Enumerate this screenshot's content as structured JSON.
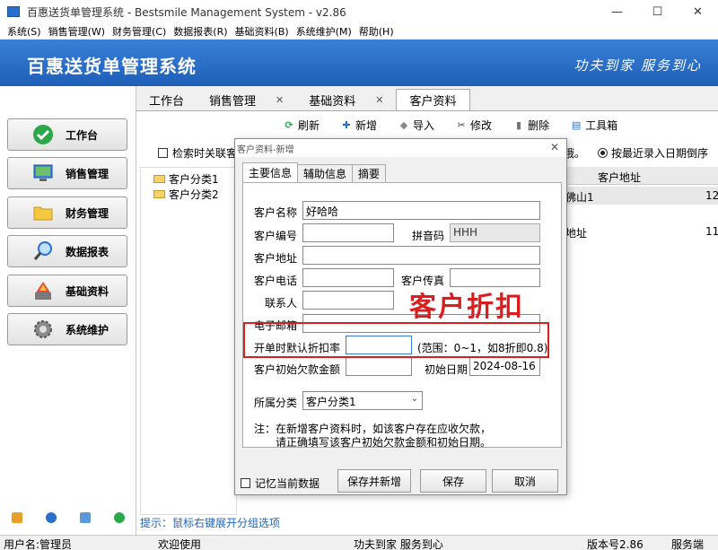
{
  "window": {
    "title": "百惠送货单管理系统 - Bestsmile Management System - v2.86",
    "minimize_glyph": "—",
    "maximize_glyph": "☐",
    "close_glyph": "✕"
  },
  "menu": [
    "系统(S)",
    "销售管理(W)",
    "财务管理(C)",
    "数据报表(R)",
    "基础资料(B)",
    "系统维护(M)",
    "帮助(H)"
  ],
  "banner": {
    "system_name": "百惠送货单管理系统",
    "slogan": "功夫到家 服务到心"
  },
  "nav": [
    {
      "label": "工作台",
      "icon": "checkmark-icon"
    },
    {
      "label": "销售管理",
      "icon": "monitor-icon"
    },
    {
      "label": "财务管理",
      "icon": "folder-icon"
    },
    {
      "label": "数据报表",
      "icon": "magnifier-icon"
    },
    {
      "label": "基础资料",
      "icon": "palette-icon"
    },
    {
      "label": "系统维护",
      "icon": "gear-icon"
    }
  ],
  "tabs": [
    {
      "label": "工作台",
      "closable": false
    },
    {
      "label": "销售管理",
      "closable": true
    },
    {
      "label": "基础资料",
      "closable": true
    },
    {
      "label": "客户资料",
      "closable": false
    }
  ],
  "toolbar": {
    "refresh": "刷新",
    "add": "新增",
    "import": "导入",
    "edit": "修改",
    "delete": "删除",
    "toolbox": "工具箱"
  },
  "search": {
    "checkbox_label": "检索时关联客",
    "radio_label": "按最近录入日期倒序",
    "partial_text": "哦。"
  },
  "tree": [
    "客户分类1",
    "客户分类2"
  ],
  "grid": {
    "column": "客户地址",
    "rows": [
      {
        "addr": "佛山1",
        "num": "12"
      },
      {
        "addr": "地址",
        "num": "11"
      }
    ]
  },
  "hint": "提示：鼠标右键展开分组选项",
  "statusbar": {
    "user": "用户名:管理员",
    "welcome": "欢迎使用",
    "slogan": "功夫到家 服务到心",
    "version": "版本号2.86",
    "service": "服务端"
  },
  "dialog": {
    "title": "客户资料-新增",
    "close_glyph": "✕",
    "tabs": [
      "主要信息",
      "辅助信息",
      "摘要"
    ],
    "fields": {
      "name_label": "客户名称",
      "name_value": "好哈哈",
      "code_label": "客户编号",
      "code_value": "",
      "pinyin_label": "拼音码",
      "pinyin_value": "HHH",
      "address_label": "客户地址",
      "address_value": "",
      "phone_label": "客户电话",
      "phone_value": "",
      "fax_label": "客户传真",
      "fax_value": "",
      "contact_label": "联系人",
      "contact_value": "",
      "email_label": "电子邮箱",
      "email_value": "",
      "discount_label": "开单时默认折扣率",
      "discount_value": "",
      "discount_hint": "(范围：0~1，如8折即0.8)",
      "init_debt_label": "客户初始欠款金额",
      "init_debt_value": "",
      "init_date_label": "初始日期",
      "init_date_value": "2024-08-16",
      "category_label": "所属分类",
      "category_value": "客户分类1"
    },
    "note_line1": "注：在新增客户资料时，如该客户存在应收欠款，",
    "note_line2": "请正确填写该客户初始欠款金额和初始日期。",
    "remember_label": "记忆当前数据",
    "save_add_label": "保存并新增",
    "save_label": "保存",
    "cancel_label": "取消"
  },
  "annotation": "客户折扣",
  "colors": {
    "banner": "#1e5fb8",
    "annotation": "#d81e1e",
    "hint": "#2066c0"
  }
}
